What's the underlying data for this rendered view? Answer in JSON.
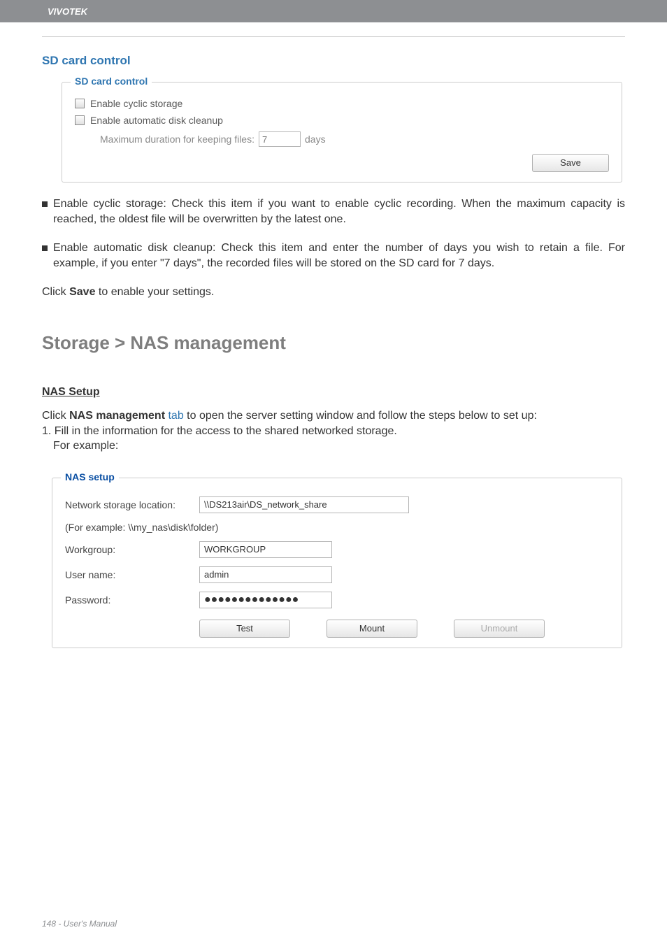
{
  "header": {
    "brand": "VIVOTEK"
  },
  "sd_section": {
    "title": "SD card control",
    "legend": "SD card control",
    "row_cyclic": "Enable cyclic storage",
    "row_cleanup": "Enable automatic disk cleanup",
    "max_label": "Maximum duration for keeping files:",
    "max_value": "7",
    "max_unit": "days",
    "save_btn": "Save"
  },
  "paras": {
    "b1_lead": "Enable cyclic storage: Check this item if you want to enable cyclic recording. When the maximum capacity is reached, the oldest file will be overwritten by the latest one.",
    "b2_lead": "Enable automatic disk cleanup: Check this item and enter the number of days you wish to retain a file. For example, if you enter \"7 days\", the recorded files will be stored on the SD card for 7 days.",
    "save_line_a": "Click ",
    "save_line_b": "Save",
    "save_line_c": " to enable your settings."
  },
  "nas_section": {
    "heading": "Storage > NAS management",
    "setup_h": "NAS Setup",
    "intro_a": "Click ",
    "intro_b": "NAS management",
    "intro_c": " tab",
    "intro_d": " to open the server setting window and follow the steps below to set up:",
    "step1": "1. Fill in the information for the access to the shared networked storage.",
    "for_example": "For example:",
    "legend": "NAS setup",
    "loc_label": "Network storage location:",
    "loc_value": "\\\\DS213air\\DS_network_share",
    "example_path": "(For example: \\\\my_nas\\disk\\folder)",
    "workgroup_label": "Workgroup:",
    "workgroup_value": "WORKGROUP",
    "user_label": "User name:",
    "user_value": "admin",
    "pw_label": "Password:",
    "pw_value": "●●●●●●●●●●●●●●",
    "btn_test": "Test",
    "btn_mount": "Mount",
    "btn_unmount": "Unmount"
  },
  "footer": {
    "text": "148 - User's Manual"
  }
}
